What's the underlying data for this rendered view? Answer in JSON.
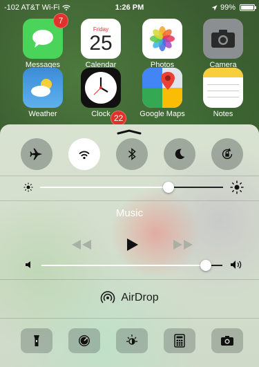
{
  "status_bar": {
    "carrier": "-102 AT&T Wi-Fi",
    "time": "1:26 PM",
    "battery": "99%",
    "battery_level": 0.99
  },
  "apps": [
    {
      "label": "Messages",
      "icon": "messages-icon",
      "color": "#4bd45a",
      "badge": "7"
    },
    {
      "label": "Calendar",
      "icon": "calendar-icon",
      "color": "#ffffff",
      "day": "Friday",
      "date": "25"
    },
    {
      "label": "Photos",
      "icon": "photos-icon",
      "color": "#ffffff"
    },
    {
      "label": "Camera",
      "icon": "camera-icon",
      "color": "#8b8f92"
    },
    {
      "label": "Weather",
      "icon": "weather-icon",
      "color": "#3b8cd8"
    },
    {
      "label": "Clock",
      "icon": "clock-icon",
      "color": "#111111"
    },
    {
      "label": "Google Maps",
      "icon": "maps-icon",
      "color": "#f3f3f3"
    },
    {
      "label": "Notes",
      "icon": "notes-icon",
      "color": "#f7cf3c"
    }
  ],
  "partial_badge": "22",
  "control_center": {
    "toggles": [
      {
        "name": "airplane-mode",
        "icon": "airplane-icon",
        "active": false
      },
      {
        "name": "wifi",
        "icon": "wifi-icon",
        "active": true
      },
      {
        "name": "bluetooth",
        "icon": "bluetooth-icon",
        "active": false
      },
      {
        "name": "do-not-disturb",
        "icon": "moon-icon",
        "active": false
      },
      {
        "name": "rotation-lock",
        "icon": "rotation-lock-icon",
        "active": false
      }
    ],
    "brightness_level": 0.7,
    "music_title": "Music",
    "volume_level": 0.91,
    "airdrop_label": "AirDrop",
    "tools": [
      {
        "name": "flashlight",
        "icon": "flashlight-icon"
      },
      {
        "name": "timer",
        "icon": "timer-icon"
      },
      {
        "name": "night-shift",
        "icon": "night-shift-icon"
      },
      {
        "name": "calculator",
        "icon": "calculator-icon"
      },
      {
        "name": "camera",
        "icon": "camera-icon"
      }
    ]
  }
}
